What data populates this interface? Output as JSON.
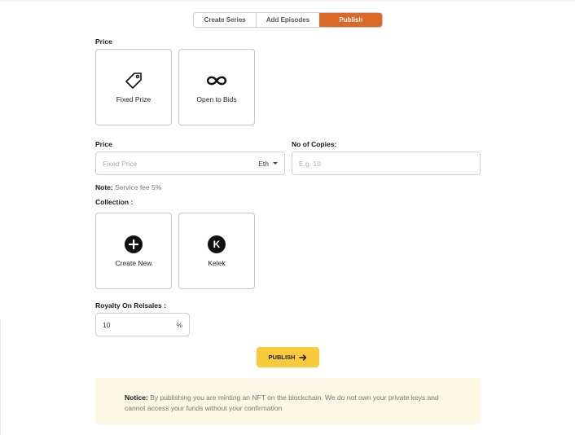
{
  "steps": [
    "Create Series",
    "Add Episodes",
    "Publish"
  ],
  "price_section_label": "Price",
  "price_options": [
    {
      "label": "Fixed Prize",
      "icon": "tag-icon"
    },
    {
      "label": "Open to Bids",
      "icon": "infinity-icon"
    }
  ],
  "price_field": {
    "label": "Price",
    "placeholder": "Fixed Price",
    "value": "",
    "currency": "Eth"
  },
  "copies_field": {
    "label": "No of Copies:",
    "placeholder": "E.g. 10",
    "value": ""
  },
  "note": {
    "label": "Note:",
    "text": "Service fee 5%"
  },
  "collection_label": "Collection :",
  "collections": [
    {
      "label": "Create New",
      "icon": "plus-circle-icon"
    },
    {
      "label": "Kelek",
      "icon": "k-letter-icon",
      "letter": "K"
    }
  ],
  "royalty": {
    "label": "Royalty On Relsales :",
    "value": "10",
    "unit": "%"
  },
  "publish_button": {
    "label": "PUBLISH",
    "icon": "arrow-right-icon"
  },
  "notice": {
    "label": "Notice:",
    "text": "By publishing you are minting an NFT on the blockchain. We do not own your private keys and cannot access your funds without your confirmation"
  },
  "colors": {
    "accent": "#dd6828",
    "publish": "#f9cb3c",
    "notice_bg": "#fdf8e6"
  }
}
